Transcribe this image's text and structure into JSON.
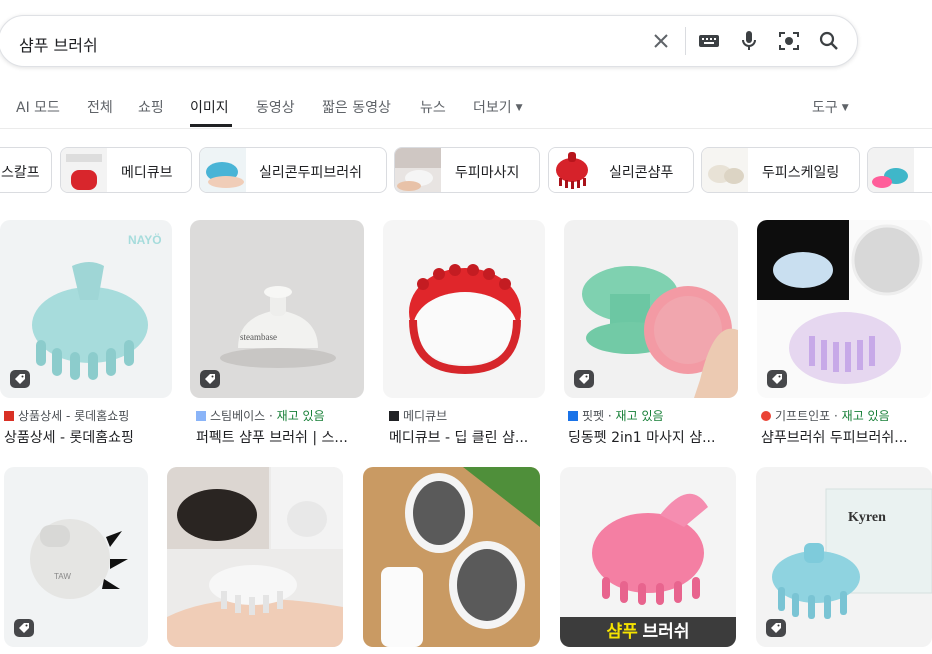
{
  "search": {
    "query": "샴푸 브러쉬"
  },
  "tabs": [
    {
      "label": "AI 모드"
    },
    {
      "label": "전체"
    },
    {
      "label": "쇼핑"
    },
    {
      "label": "이미지"
    },
    {
      "label": "동영상"
    },
    {
      "label": "짧은 동영상"
    },
    {
      "label": "뉴스"
    },
    {
      "label": "더보기"
    }
  ],
  "tools": {
    "label": "도구"
  },
  "chips": [
    {
      "label": "스칼프"
    },
    {
      "label": "메디큐브"
    },
    {
      "label": "실리콘두피브러쉬"
    },
    {
      "label": "두피마사지"
    },
    {
      "label": "실리콘샴푸"
    },
    {
      "label": "두피스케일링"
    }
  ],
  "results_row1": [
    {
      "source": "상품상세 - 롯데홈쇼핑",
      "stock": "",
      "title": "상품상세 - 롯데홈쇼핑",
      "brand_text": "NAYÖ"
    },
    {
      "source": "스팀베이스",
      "stock": "재고 있음",
      "title": "퍼펙트 샴푸 브러쉬 | 스...",
      "brand_text": "steambase"
    },
    {
      "source": "메디큐브",
      "stock": "",
      "title": "메디큐브 - 딥 클린 샴..."
    },
    {
      "source": "핏펫",
      "stock": "재고 있음",
      "title": "딩동펫 2in1 마사지 샴..."
    },
    {
      "source": "기프트인포",
      "stock": "재고 있음",
      "title": "샴푸브러쉬 두피브러쉬..."
    }
  ],
  "results_row2": [
    {
      "brand_text": "TAW"
    },
    {},
    {},
    {
      "overlay_highlight": "샴푸",
      "overlay_rest": " 브러쉬"
    },
    {
      "brand_text": "Kyren"
    }
  ],
  "colors": {
    "accent_mint": "#9fd8d6",
    "red": "#e0262b",
    "pink": "#f47fa3"
  }
}
